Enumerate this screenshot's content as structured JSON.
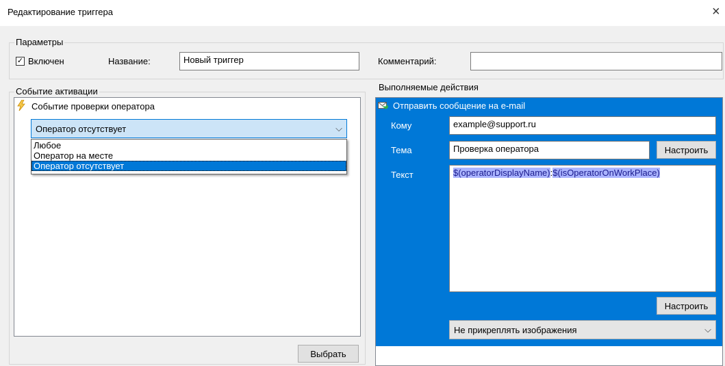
{
  "window": {
    "title": "Редактирование триггера",
    "close_glyph": "×"
  },
  "params": {
    "legend": "Параметры",
    "enabled_label": "Включен",
    "enabled_checked": true,
    "check_glyph": "✓",
    "name_label": "Название:",
    "name_value": "Новый триггер",
    "comment_label": "Комментарий:",
    "comment_value": ""
  },
  "activation": {
    "legend": "Событие активации",
    "event_icon": "lightning-icon",
    "event_label": "Событие проверки оператора",
    "combo_value": "Оператор отсутствует",
    "chevron": "⌵",
    "options": [
      "Любое",
      "Оператор на месте",
      "Оператор отсутствует"
    ],
    "selected_index": 2,
    "choose_button": "Выбрать"
  },
  "actions": {
    "legend": "Выполняемые действия",
    "action_icon": "send-email-icon",
    "action_title": "Отправить сообщение на e-mail",
    "to_label": "Кому",
    "to_value": "example@support.ru",
    "subject_label": "Тема",
    "subject_value": "Проверка оператора",
    "subject_configure": "Настроить",
    "text_label": "Текст",
    "text_part1": "$(operatorDisplayName)",
    "text_sep": ":",
    "text_part2": "$(isOperatorOnWorkPlace)",
    "text_configure": "Настроить",
    "image_option": "Не прикреплять изображения",
    "chevron": "⌵"
  },
  "colors": {
    "accent": "#0078d7",
    "dialog_bg": "#f0f0f0",
    "text_selection": "#aab4ff"
  }
}
